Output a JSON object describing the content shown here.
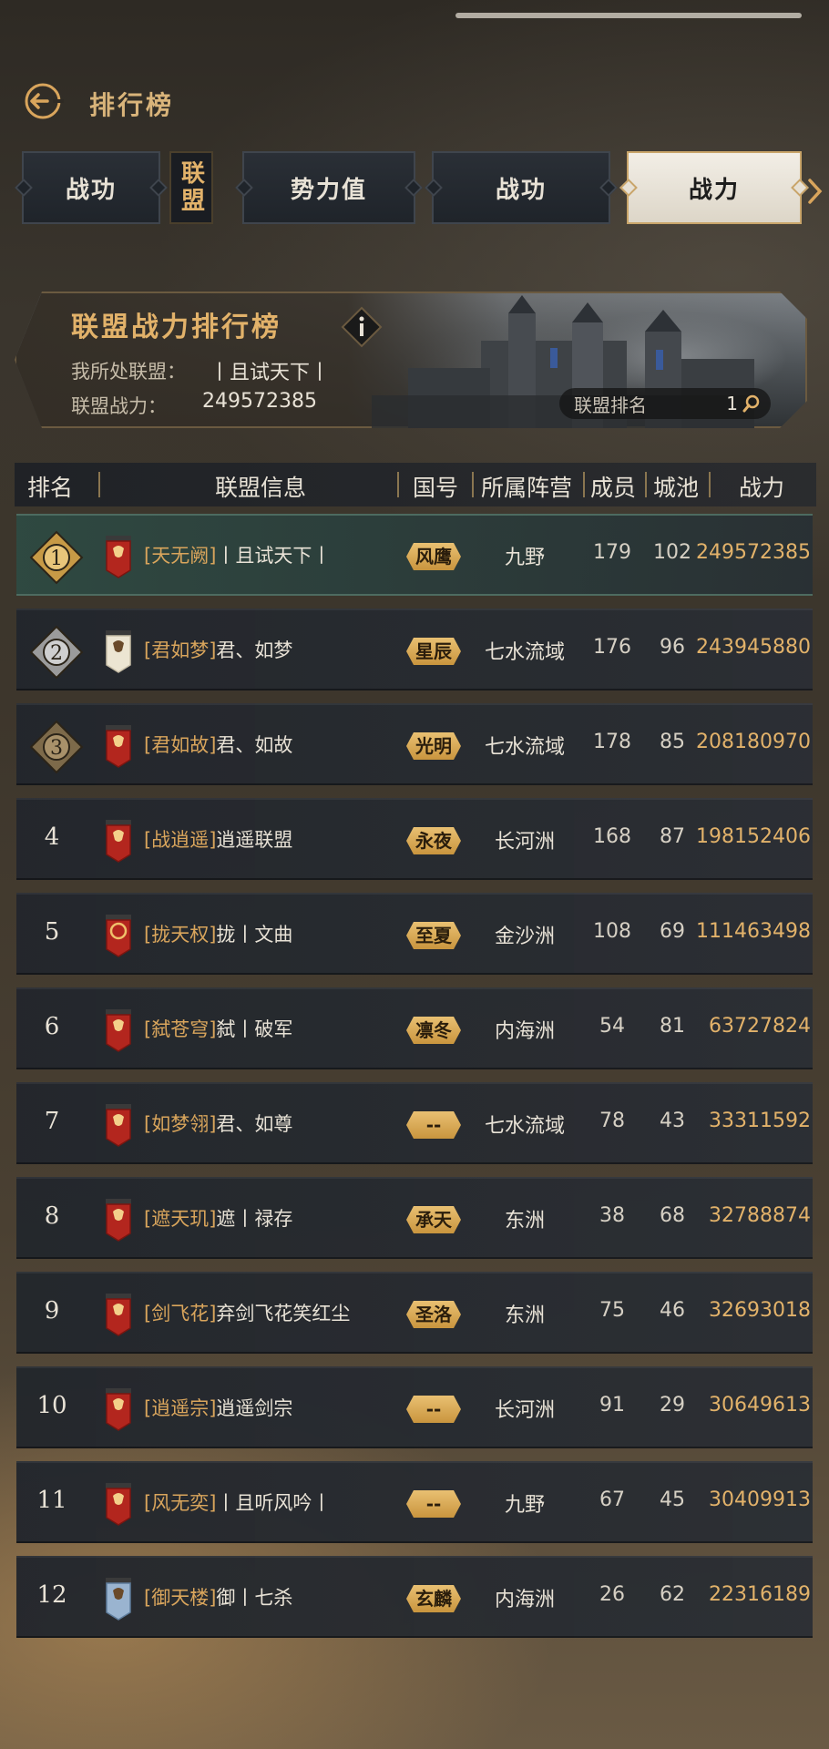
{
  "header": {
    "title": "排行榜"
  },
  "tabs": {
    "group_label": "联盟",
    "items": [
      {
        "label": "战功"
      },
      {
        "label": "势力值"
      },
      {
        "label": "战功"
      },
      {
        "label": "战力"
      }
    ],
    "active": "战力"
  },
  "banner": {
    "title": "联盟战力排行榜",
    "my_alliance_label": "我所处联盟：",
    "my_alliance_value": "丨且试天下丨",
    "power_label": "联盟战力：",
    "power_value": "249572385",
    "rank_label": "联盟排名",
    "rank_value": "1"
  },
  "table": {
    "columns": [
      "排名",
      "联盟信息",
      "国号",
      "所属阵营",
      "成员",
      "城池",
      "战力"
    ],
    "rows": [
      {
        "rank": "1",
        "tag": "[天无阙]",
        "name": "丨且试天下丨",
        "nation": "风鹰",
        "camp": "九野",
        "members": "179",
        "cities": "102",
        "power": "249572385",
        "flag": "red"
      },
      {
        "rank": "2",
        "tag": "[君如梦]",
        "name": "君、如梦",
        "nation": "星辰",
        "camp": "七水流域",
        "members": "176",
        "cities": "96",
        "power": "243945880",
        "flag": "white"
      },
      {
        "rank": "3",
        "tag": "[君如故]",
        "name": "君、如故",
        "nation": "光明",
        "camp": "七水流域",
        "members": "178",
        "cities": "85",
        "power": "208180970",
        "flag": "red"
      },
      {
        "rank": "4",
        "tag": "[战逍遥]",
        "name": "逍遥联盟",
        "nation": "永夜",
        "camp": "长河洲",
        "members": "168",
        "cities": "87",
        "power": "198152406",
        "flag": "red"
      },
      {
        "rank": "5",
        "tag": "[拢天权]",
        "name": "拢丨文曲",
        "nation": "至夏",
        "camp": "金沙洲",
        "members": "108",
        "cities": "69",
        "power": "111463498",
        "flag": "red-ring"
      },
      {
        "rank": "6",
        "tag": "[弑苍穹]",
        "name": "弑丨破军",
        "nation": "凛冬",
        "camp": "内海洲",
        "members": "54",
        "cities": "81",
        "power": "63727824",
        "flag": "red"
      },
      {
        "rank": "7",
        "tag": "[如梦翎]",
        "name": "君、如尊",
        "nation": "--",
        "camp": "七水流域",
        "members": "78",
        "cities": "43",
        "power": "33311592",
        "flag": "red"
      },
      {
        "rank": "8",
        "tag": "[遮天玑]",
        "name": "遮丨禄存",
        "nation": "承天",
        "camp": "东洲",
        "members": "38",
        "cities": "68",
        "power": "32788874",
        "flag": "red"
      },
      {
        "rank": "9",
        "tag": "[剑飞花]",
        "name": "弃剑飞花笑红尘",
        "nation": "圣洛",
        "camp": "东洲",
        "members": "75",
        "cities": "46",
        "power": "32693018",
        "flag": "red"
      },
      {
        "rank": "10",
        "tag": "[逍遥宗]",
        "name": "逍遥剑宗",
        "nation": "--",
        "camp": "长河洲",
        "members": "91",
        "cities": "29",
        "power": "30649613",
        "flag": "red"
      },
      {
        "rank": "11",
        "tag": "[风无奕]",
        "name": "丨且听风吟丨",
        "nation": "--",
        "camp": "九野",
        "members": "67",
        "cities": "45",
        "power": "30409913",
        "flag": "red"
      },
      {
        "rank": "12",
        "tag": "[御天楼]",
        "name": "御丨七杀",
        "nation": "玄麟",
        "camp": "内海洲",
        "members": "26",
        "cities": "62",
        "power": "22316189",
        "flag": "blue"
      }
    ]
  },
  "colors": {
    "accent": "#e2b26a",
    "row_bg": "#22262c",
    "active_tab": "#f2eee6"
  }
}
